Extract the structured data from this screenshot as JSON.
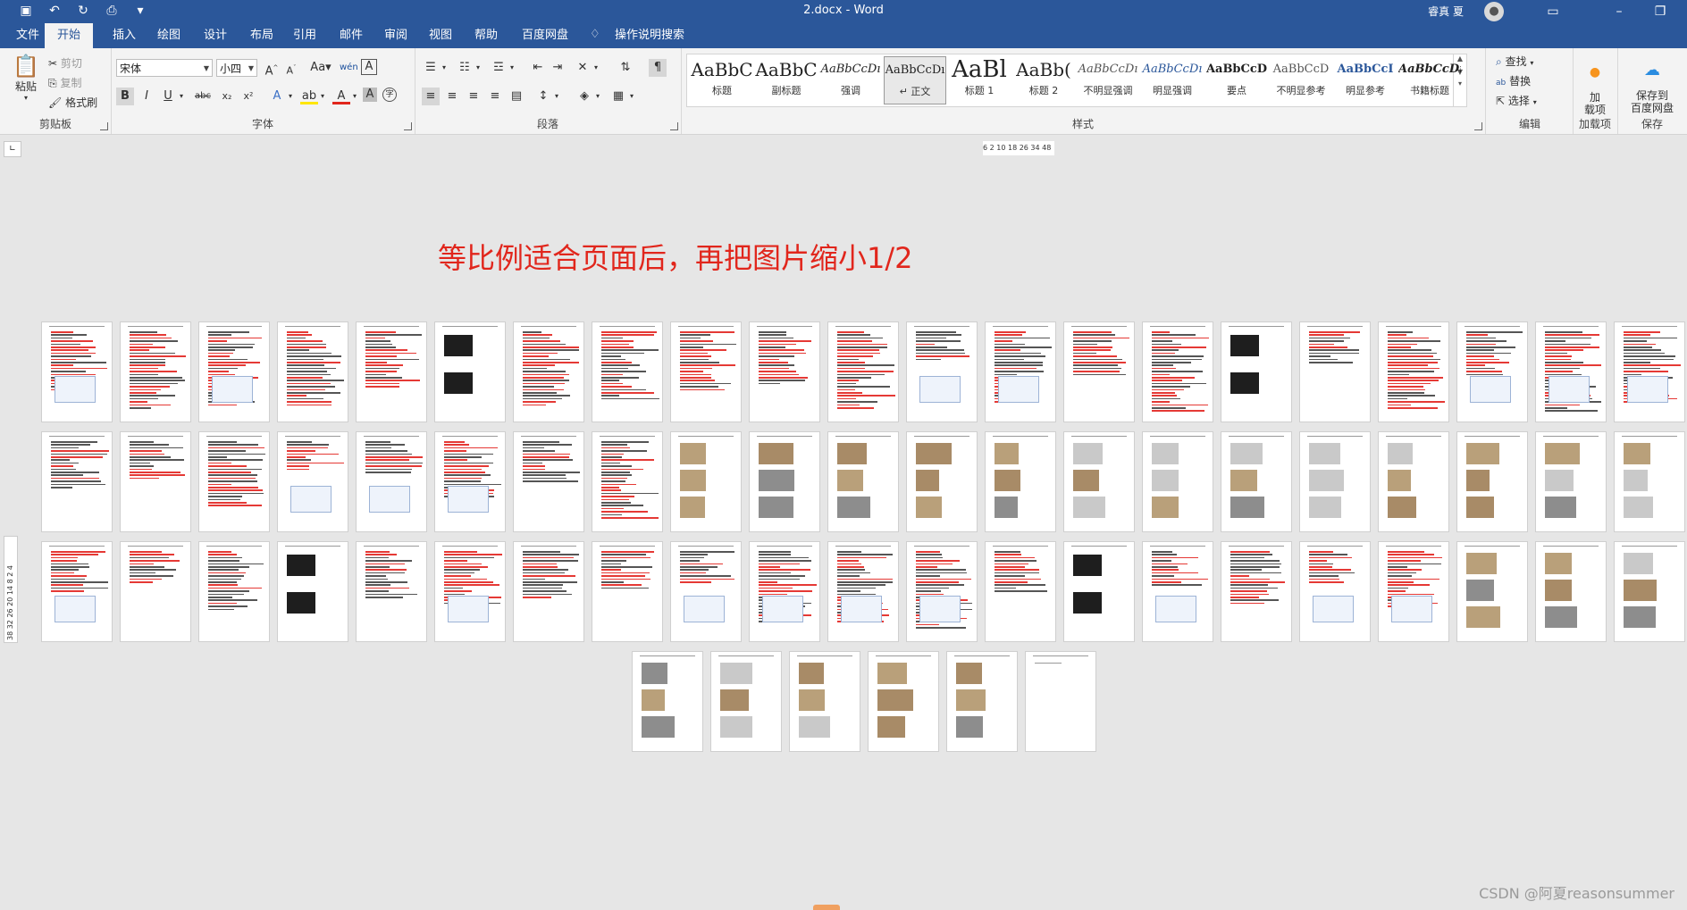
{
  "window": {
    "title": "2.docx  -  Word",
    "user": "睿真 夏"
  },
  "tabs": [
    "文件",
    "开始",
    "插入",
    "绘图",
    "设计",
    "布局",
    "引用",
    "邮件",
    "审阅",
    "视图",
    "帮助",
    "百度网盘"
  ],
  "active_tab": "开始",
  "tell_me": "操作说明搜索",
  "clipboard": {
    "paste": "粘贴",
    "cut": "剪切",
    "copy": "复制",
    "format_painter": "格式刷",
    "label": "剪贴板"
  },
  "font": {
    "name": "宋体",
    "size": "小四",
    "label": "字体",
    "grow": "A",
    "shrink": "A",
    "case": "Aa",
    "bold": "B",
    "italic": "I",
    "underline": "U",
    "strike": "abc",
    "sub": "x₂",
    "sup": "x²"
  },
  "paragraph": {
    "label": "段落"
  },
  "styles": {
    "label": "样式",
    "items": [
      {
        "sample": "AaBbC",
        "name": "标题"
      },
      {
        "sample": "AaBbC",
        "name": "副标题"
      },
      {
        "sample": "AaBbCcDı",
        "name": "强调"
      },
      {
        "sample": "AaBbCcDı",
        "name": "↵ 正文"
      },
      {
        "sample": "AaBl",
        "name": "标题 1"
      },
      {
        "sample": "AaBb(",
        "name": "标题 2"
      },
      {
        "sample": "AaBbCcDı",
        "name": "不明显强调"
      },
      {
        "sample": "AaBbCcDı",
        "name": "明显强调"
      },
      {
        "sample": "AaBbCcD",
        "name": "要点"
      },
      {
        "sample": "AaBbCcD",
        "name": "不明显参考"
      },
      {
        "sample": "AaBbCcI",
        "name": "明显参考"
      },
      {
        "sample": "AaBbCcDı",
        "name": "书籍标题"
      }
    ]
  },
  "editing": {
    "find": "查找",
    "replace": "替换",
    "select": "选择",
    "label": "编辑"
  },
  "addins": {
    "button": "加\n载项",
    "label": "加载项"
  },
  "save": {
    "button": "保存到\n百度网盘",
    "label": "保存"
  },
  "ruler": {
    "horizontal": "6   2  10 18 26 34   48",
    "vertical": "38 32 26 20 14  8  2  4"
  },
  "annotation": "等比例适合页面后，再把图片缩小1/2",
  "watermark": "CSDN @阿夏reasonsummer",
  "pages": {
    "rows": [
      21,
      21,
      21,
      6
    ],
    "total": 69
  },
  "colors": {
    "accent": "#2b579a",
    "annotation": "#e1261c"
  }
}
